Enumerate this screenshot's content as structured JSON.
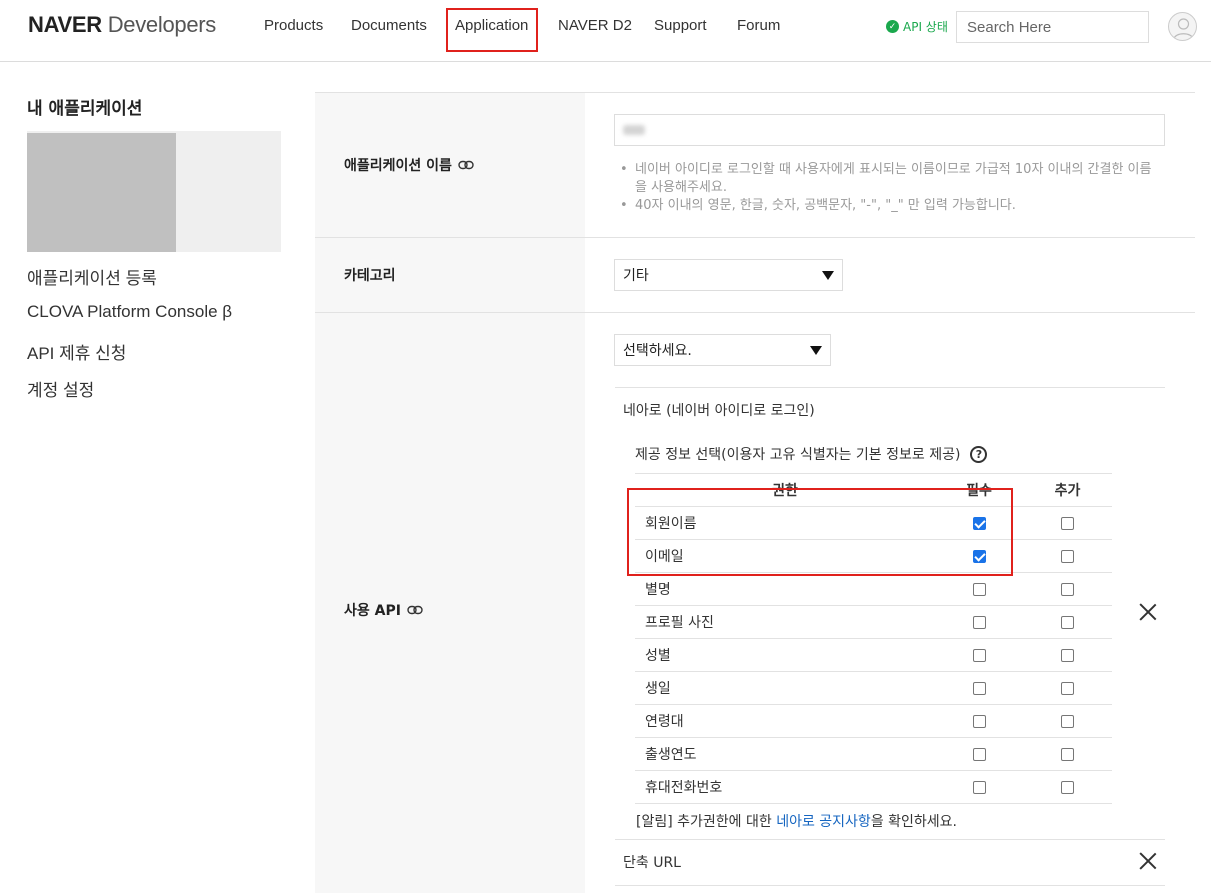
{
  "header": {
    "logo_bold": "NAVER",
    "logo_light": " Developers",
    "nav": [
      "Products",
      "Documents",
      "Application",
      "NAVER D2",
      "Support",
      "Forum"
    ],
    "api_status": "API 상태",
    "search_placeholder": "Search Here"
  },
  "sidebar": {
    "title": "내 애플리케이션",
    "links": [
      "애플리케이션 등록",
      "CLOVA Platform Console β",
      "API 제휴 신청",
      "계정 설정"
    ]
  },
  "form": {
    "app_name_label": "애플리케이션 이름",
    "app_name_help": [
      "네이버 아이디로 로그인할 때 사용자에게 표시되는 이름이므로 가급적 10자 이내의 간결한 이름을 사용해주세요.",
      "40자 이내의 영문, 한글, 숫자, 공백문자, \"-\", \"_\" 만 입력 가능합니다."
    ],
    "category_label": "카테고리",
    "category_value": "기타",
    "api_label": "사용 API",
    "api_select": "선택하세요.",
    "api_name": "네아로 (네이버 아이디로 로그인)",
    "provide_title": "제공 정보 선택(이용자 고유 식별자는 기본 정보로 제공)",
    "columns": [
      "권한",
      "필수",
      "추가"
    ],
    "permissions": [
      {
        "name": "회원이름",
        "required": true,
        "extra": false
      },
      {
        "name": "이메일",
        "required": true,
        "extra": false
      },
      {
        "name": "별명",
        "required": false,
        "extra": false
      },
      {
        "name": "프로필 사진",
        "required": false,
        "extra": false
      },
      {
        "name": "성별",
        "required": false,
        "extra": false
      },
      {
        "name": "생일",
        "required": false,
        "extra": false
      },
      {
        "name": "연령대",
        "required": false,
        "extra": false
      },
      {
        "name": "출생연도",
        "required": false,
        "extra": false
      },
      {
        "name": "휴대전화번호",
        "required": false,
        "extra": false
      }
    ],
    "notice_prefix": "[알림] 추가권한에 대한 ",
    "notice_link": "네아로 공지사항",
    "notice_suffix": "을 확인하세요.",
    "short_url": "단축 URL"
  },
  "colors": {
    "highlight": "#e0211c",
    "status_green": "#1aa84d",
    "link_blue": "#1565c0",
    "check_blue": "#1a73e8"
  }
}
